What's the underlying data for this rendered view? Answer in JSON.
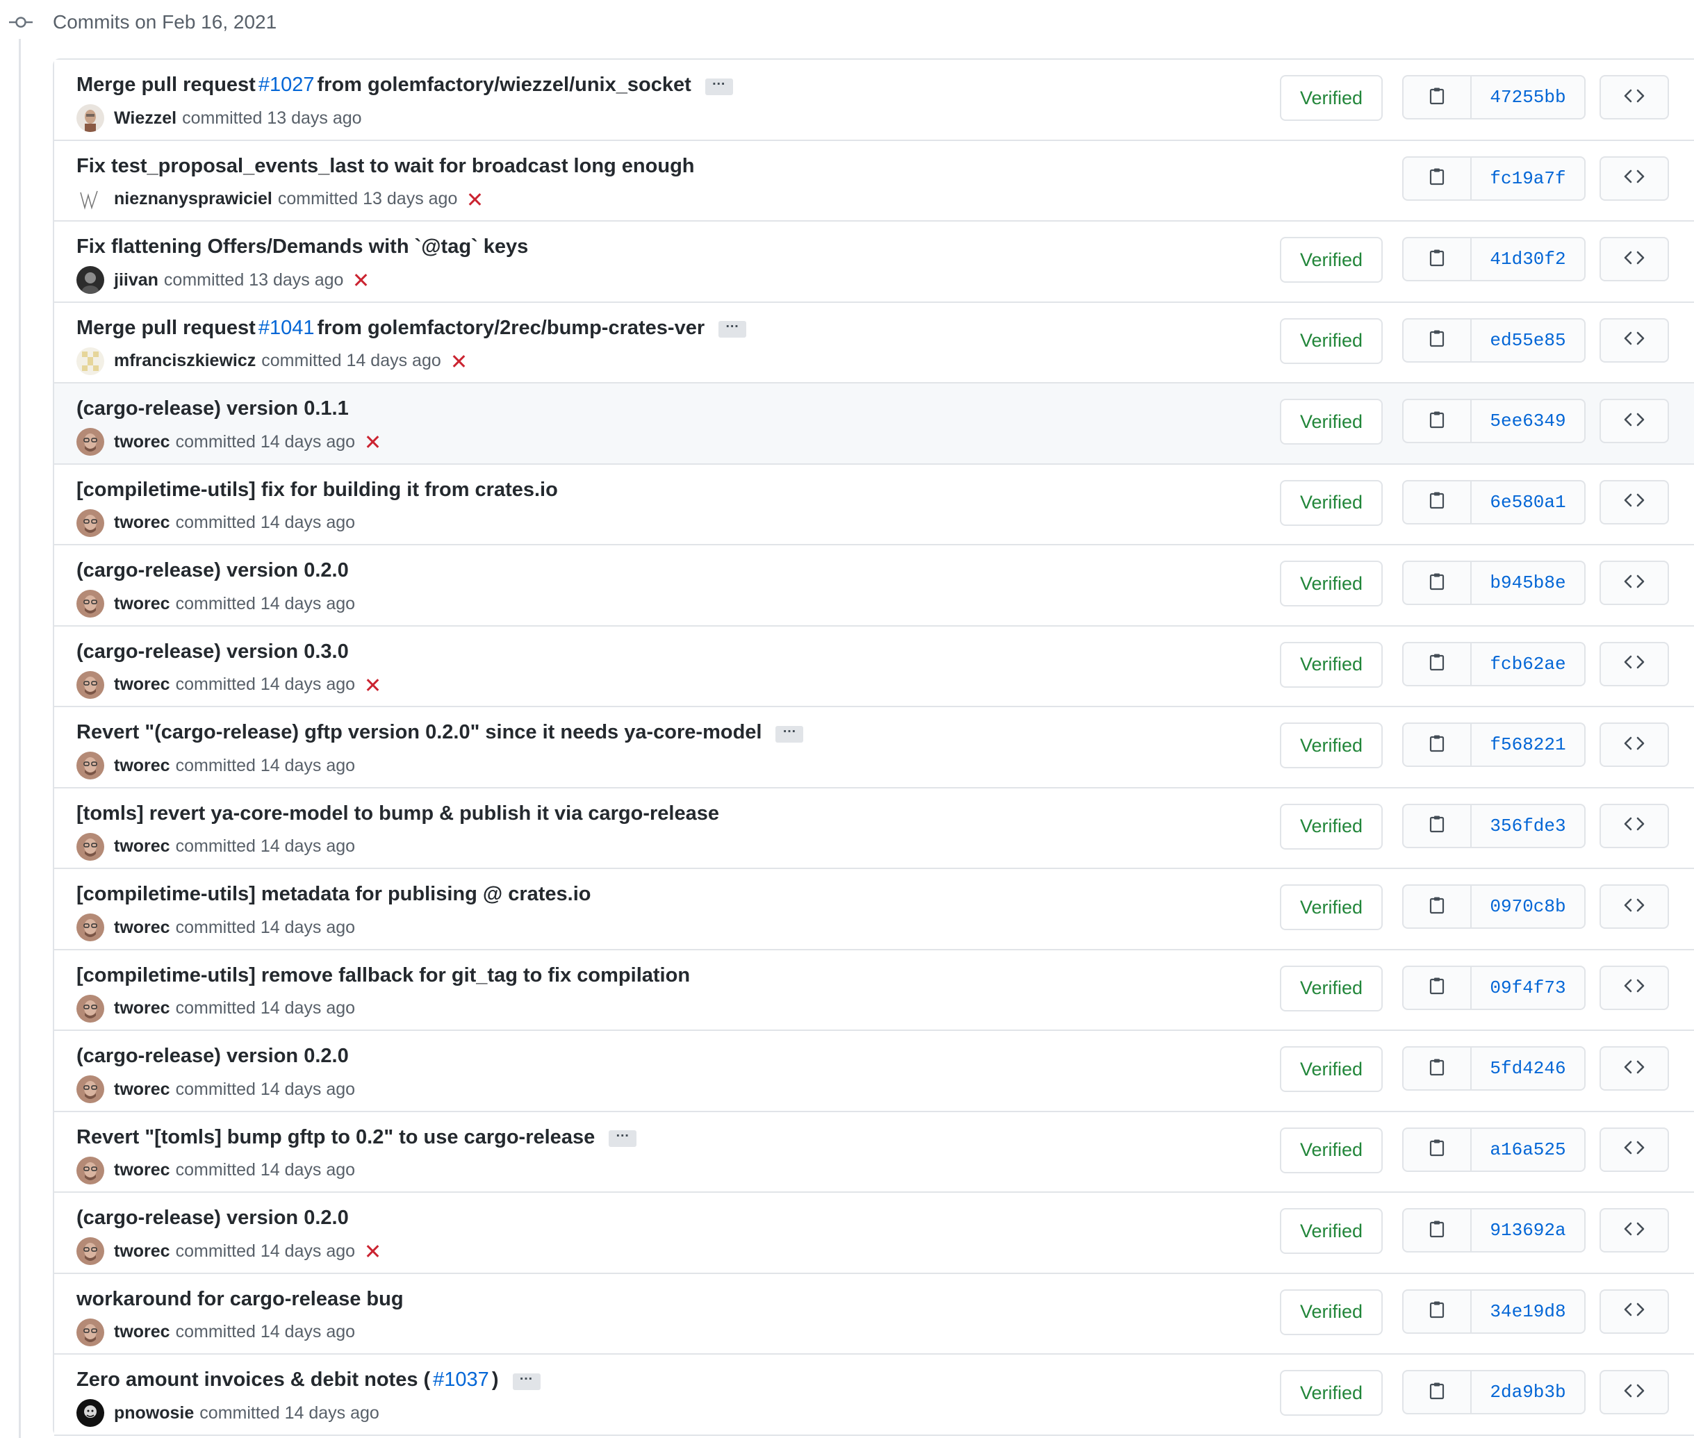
{
  "group": {
    "title": "Commits on Feb 16, 2021"
  },
  "labels": {
    "committed": "committed",
    "verified": "Verified"
  },
  "colors": {
    "verified": "#22863a",
    "link": "#0366d6",
    "fail": "#cb2431",
    "border": "#e1e4e8"
  },
  "commits": [
    {
      "title_pre": "Merge pull request",
      "pr": "#1027",
      "title_post": "from golemfactory/wiezzel/unix_socket",
      "title": "",
      "has_ellipsis": true,
      "author": "Wiezzel",
      "time": "13 days ago",
      "failed": false,
      "verified": true,
      "sha": "47255bb",
      "avatar": "wiezzel"
    },
    {
      "title": "Fix test_proposal_events_last to wait for broadcast long enough",
      "has_ellipsis": false,
      "author": "nieznanysprawiciel",
      "time": "13 days ago",
      "failed": true,
      "verified": false,
      "sha": "fc19a7f",
      "avatar": "sketch"
    },
    {
      "title": "Fix flattening Offers/Demands with `@tag` keys",
      "has_ellipsis": false,
      "author": "jiivan",
      "time": "13 days ago",
      "failed": true,
      "verified": true,
      "sha": "41d30f2",
      "avatar": "dark"
    },
    {
      "title_pre": "Merge pull request",
      "pr": "#1041",
      "title_post": "from golemfactory/2rec/bump-crates-ver",
      "title": "",
      "has_ellipsis": true,
      "author": "mfranciszkiewicz",
      "time": "14 days ago",
      "failed": true,
      "verified": true,
      "sha": "ed55e85",
      "avatar": "identicon"
    },
    {
      "title": "(cargo-release) version 0.1.1",
      "has_ellipsis": false,
      "author": "tworec",
      "time": "14 days ago",
      "failed": true,
      "verified": true,
      "sha": "5ee6349",
      "avatar": "tworec",
      "highlight": true
    },
    {
      "title": "[compiletime-utils] fix for building it from crates.io",
      "has_ellipsis": false,
      "author": "tworec",
      "time": "14 days ago",
      "failed": false,
      "verified": true,
      "sha": "6e580a1",
      "avatar": "tworec"
    },
    {
      "title": "(cargo-release) version 0.2.0",
      "has_ellipsis": false,
      "author": "tworec",
      "time": "14 days ago",
      "failed": false,
      "verified": true,
      "sha": "b945b8e",
      "avatar": "tworec"
    },
    {
      "title": "(cargo-release) version 0.3.0",
      "has_ellipsis": false,
      "author": "tworec",
      "time": "14 days ago",
      "failed": true,
      "verified": true,
      "sha": "fcb62ae",
      "avatar": "tworec"
    },
    {
      "title": "Revert \"(cargo-release) gftp version 0.2.0\" since it needs ya-core-model",
      "has_ellipsis": true,
      "author": "tworec",
      "time": "14 days ago",
      "failed": false,
      "verified": true,
      "sha": "f568221",
      "avatar": "tworec"
    },
    {
      "title": "[tomls] revert ya-core-model to bump & publish it via cargo-release",
      "has_ellipsis": false,
      "author": "tworec",
      "time": "14 days ago",
      "failed": false,
      "verified": true,
      "sha": "356fde3",
      "avatar": "tworec"
    },
    {
      "title": "[compiletime-utils] metadata for publising @ crates.io",
      "has_ellipsis": false,
      "author": "tworec",
      "time": "14 days ago",
      "failed": false,
      "verified": true,
      "sha": "0970c8b",
      "avatar": "tworec"
    },
    {
      "title": "[compiletime-utils] remove fallback for git_tag to fix compilation",
      "has_ellipsis": false,
      "author": "tworec",
      "time": "14 days ago",
      "failed": false,
      "verified": true,
      "sha": "09f4f73",
      "avatar": "tworec"
    },
    {
      "title": "(cargo-release) version 0.2.0",
      "has_ellipsis": false,
      "author": "tworec",
      "time": "14 days ago",
      "failed": false,
      "verified": true,
      "sha": "5fd4246",
      "avatar": "tworec"
    },
    {
      "title": "Revert \"[tomls] bump gftp to 0.2\" to use cargo-release",
      "has_ellipsis": true,
      "author": "tworec",
      "time": "14 days ago",
      "failed": false,
      "verified": true,
      "sha": "a16a525",
      "avatar": "tworec"
    },
    {
      "title": "(cargo-release) version 0.2.0",
      "has_ellipsis": false,
      "author": "tworec",
      "time": "14 days ago",
      "failed": true,
      "verified": true,
      "sha": "913692a",
      "avatar": "tworec"
    },
    {
      "title": "workaround for cargo-release bug",
      "has_ellipsis": false,
      "author": "tworec",
      "time": "14 days ago",
      "failed": false,
      "verified": true,
      "sha": "34e19d8",
      "avatar": "tworec"
    },
    {
      "title_pre": "Zero amount invoices & debit notes (",
      "pr": "#1037",
      "title_post": ")",
      "title": "",
      "has_ellipsis": true,
      "author": "pnowosie",
      "time": "14 days ago",
      "failed": false,
      "verified": true,
      "sha": "2da9b3b",
      "avatar": "pnowosie"
    }
  ]
}
